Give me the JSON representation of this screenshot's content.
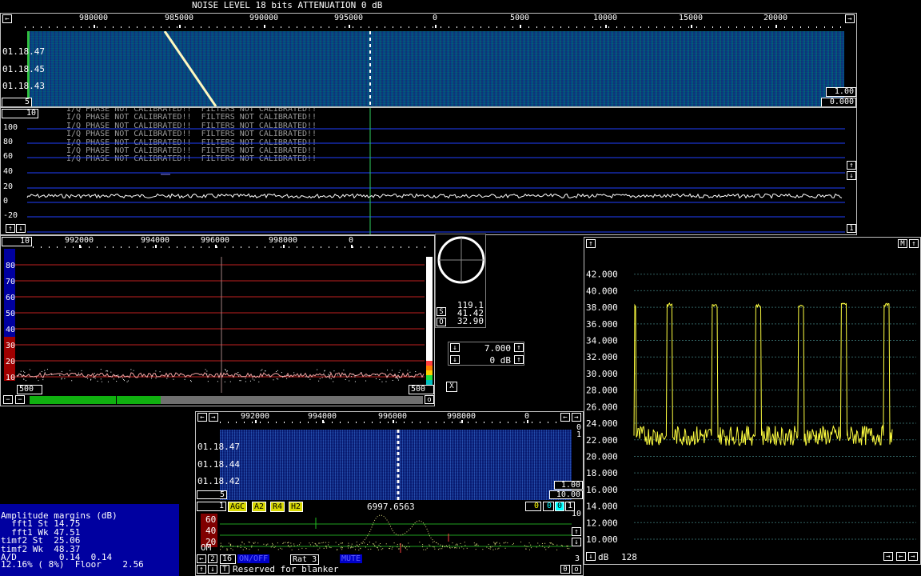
{
  "top_status": "NOISE LEVEL 18 bits ATTENUATION 0 dB",
  "main_freq_ticks": [
    "980000",
    "985000",
    "990000",
    "995000",
    "0",
    "5000",
    "10000",
    "15000",
    "20000"
  ],
  "main_wf_times": [
    "01.18.47",
    "01.18.45",
    "01.18.43"
  ],
  "main_wf_left_box": "5",
  "main_wf_right_boxes": [
    "1.00",
    "0.000"
  ],
  "spectrum_box": "10",
  "spectrum_yticks": [
    "100",
    "80",
    "60",
    "40",
    "20",
    "0",
    "-20"
  ],
  "warning_lines": [
    "I/Q PHASE NOT CALIBRATED!!  FILTERS NOT CALIBRATED!!",
    "I/Q PHASE NOT CALIBRATED!!  FILTERS NOT CALIBRATED!!",
    "I/Q PHASE NOT CALIBRATED!!  FILTERS NOT CALIBRATED!!",
    "I/Q PHASE NOT CALIBRATED!!  FILTERS NOT CALIBRATED!!",
    "I/Q PHASE NOT CALIBRATED!!  FILTERS NOT CALIBRATED!!",
    "I/Q PHASE NOT CALIBRATED!!  FILTERS NOT CALIBRATED!!",
    "I/Q PHASE NOT CALIBRATED!!  FILTERS NOT CALIBRATED!!"
  ],
  "spec_corner": "1",
  "hires": {
    "box": "10",
    "ticks": [
      "992000",
      "994000",
      "996000",
      "998000",
      "0"
    ],
    "yticks": [
      "80",
      "70",
      "60",
      "50",
      "40",
      "30",
      "20",
      "10"
    ],
    "left_box": "500",
    "right_box": "500"
  },
  "smeter": {
    "s_label": "S",
    "o_label": "O",
    "values": [
      "119.1",
      "41.42",
      "32.90"
    ],
    "gain": "7.000",
    "db": "0 dB",
    "x_label": "X"
  },
  "baseband": {
    "ticks": [
      "992000",
      "994000",
      "996000",
      "998000",
      "0"
    ],
    "times": [
      "01.18.47",
      "01.18.44",
      "01.18.42"
    ],
    "left_box": "5",
    "right_boxes": [
      "1.00",
      "10.00"
    ],
    "side_nums": [
      "0",
      "1"
    ],
    "frequency": "6997.6563",
    "ch_num": "1",
    "agc_buttons": [
      "AGC",
      "A2",
      "R4",
      "H2"
    ],
    "right_ch_boxes": [
      "0",
      "0",
      "0",
      "1"
    ],
    "plot_scale": "10",
    "plot_y": [
      "60",
      "40",
      "20"
    ],
    "om_label": "OM",
    "bottom_row1_left": "2",
    "bottom_row1_num": "16",
    "bottom_row1_blue": "ON/OFF",
    "rat": "Rat  3",
    "bottom_row1_blue2": "MUTE",
    "bottom_row1_right": "3",
    "blanker_t": "T",
    "blanker_text": "Reserved for blanker",
    "blanker_right": "0"
  },
  "amplitude": {
    "title": "Amplitude margins (dB)",
    "rows": [
      {
        "label": "  fft1 St",
        "value": "14.75"
      },
      {
        "label": "  fft1 Wk",
        "value": "47.51"
      },
      {
        "label": "timf2 St",
        "value": "25.06"
      },
      {
        "label": "timf2 Wk",
        "value": "48.37"
      },
      {
        "label": "A/D",
        "value": " 0.14  0.14"
      }
    ],
    "bottom": "12.16% ( 8%)  Floor    2.56"
  },
  "right_panel": {
    "m_label": "M",
    "db_label": "dB",
    "db_value": "128"
  },
  "chart_data": {
    "type": "line",
    "ylim": [
      10,
      44
    ],
    "yticks": [
      "42.000",
      "40.000",
      "38.000",
      "36.000",
      "34.000",
      "32.000",
      "30.000",
      "28.000",
      "26.000",
      "24.000",
      "22.000",
      "20.000",
      "18.000",
      "16.000",
      "14.000",
      "12.000",
      "10.000"
    ],
    "pulses": [
      {
        "start": 0,
        "end": 3,
        "high": 38.2
      },
      {
        "start": 40,
        "end": 48,
        "high": 38.3
      },
      {
        "start": 96,
        "end": 104,
        "high": 38.2
      },
      {
        "start": 150,
        "end": 158,
        "high": 38.2
      },
      {
        "start": 203,
        "end": 211,
        "high": 38.1
      },
      {
        "start": 256,
        "end": 264,
        "high": 38.4
      },
      {
        "start": 309,
        "end": 317,
        "high": 38.3
      }
    ],
    "low_level": 22.5,
    "x_max": 320
  }
}
